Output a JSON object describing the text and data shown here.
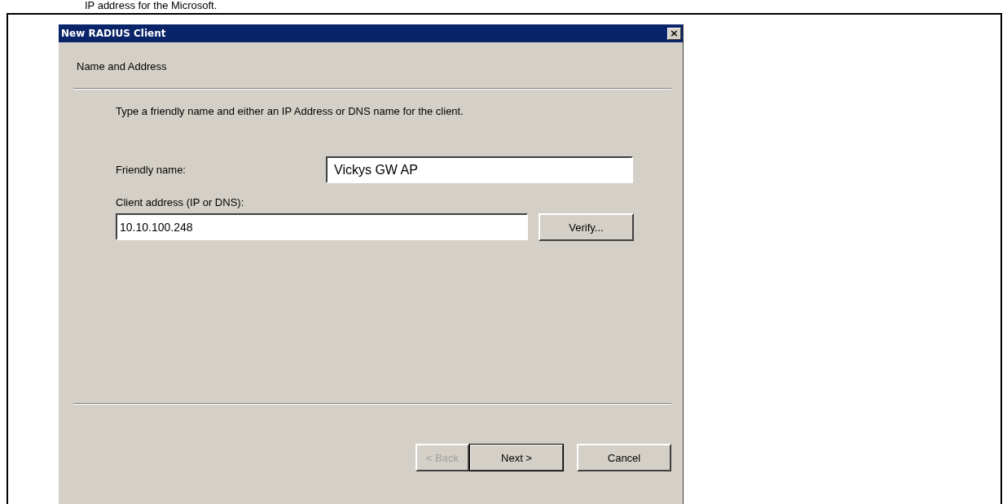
{
  "document_text": "IP address for the Microsoft.",
  "window": {
    "title": "New RADIUS Client",
    "close": "×"
  },
  "page_header": "Name and Address",
  "description": "Type a friendly name and either an IP Address or DNS name for the client.",
  "fields": [
    {
      "label": "Friendly name:",
      "value": "Vickys GW AP",
      "kind": "large"
    },
    {
      "label": "Client address (IP or DNS):",
      "value": "10.10.100.248",
      "kind": "small"
    }
  ],
  "verify_button": {
    "label": "Verify..."
  },
  "buttons": [
    {
      "label": "< Back",
      "disabled": true,
      "default": false
    },
    {
      "label": "Next >",
      "disabled": false,
      "default": true
    },
    {
      "label": "Cancel",
      "disabled": false,
      "default": false
    }
  ]
}
